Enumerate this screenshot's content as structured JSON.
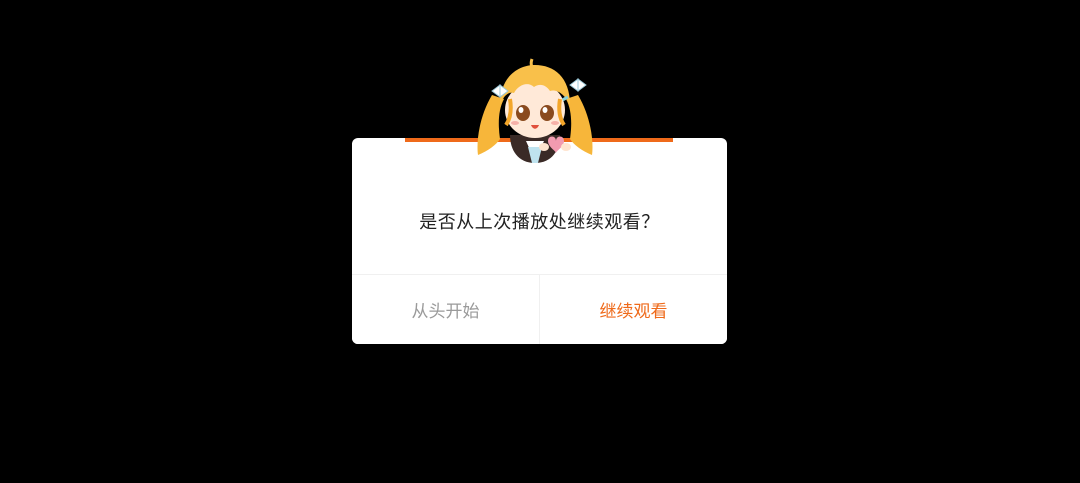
{
  "dialog": {
    "message": "是否从上次播放处继续观看？",
    "restart_label": "从头开始",
    "continue_label": "继续观看"
  },
  "colors": {
    "accent": "#ef6a1a",
    "secondary_text": "#9a9a9a",
    "primary_text": "#222222",
    "background": "#000000",
    "dialog_bg": "#ffffff"
  },
  "mascot": {
    "icon": "anime-girl-mascot-icon"
  }
}
